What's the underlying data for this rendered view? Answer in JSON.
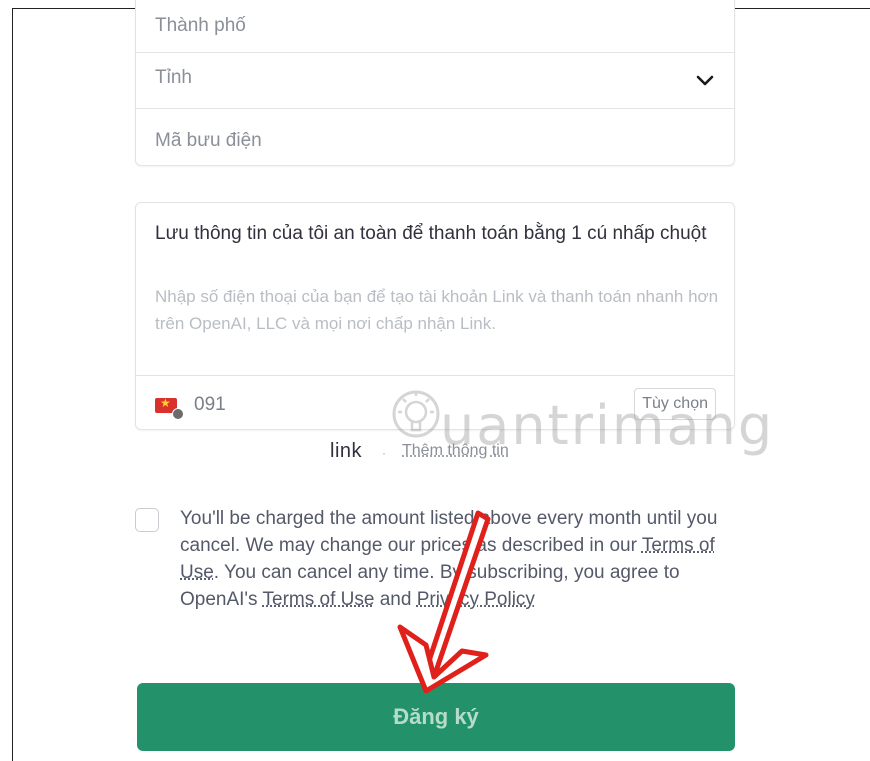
{
  "address": {
    "city_placeholder": "Thành phố",
    "province_placeholder": "Tỉnh",
    "zip_placeholder": "Mã bưu điện"
  },
  "link_save": {
    "title": "Lưu thông tin của tôi an toàn để thanh toán bằng 1 cú nhấp chuột",
    "description": "Nhập số điện thoại của bạn để tạo tài khoản Link và thanh toán nhanh hơn trên OpenAI, LLC và mọi nơi chấp nhận Link.",
    "phone_value": "091",
    "optional_label": "Tùy chọn"
  },
  "link_footer": {
    "brand": "link",
    "separator": "·",
    "more_info": "Thêm thông tin"
  },
  "consent": {
    "part1": "You'll be charged the amount listed above every month until you cancel. We may change our prices as described in our ",
    "terms1": "Terms of Use",
    "part2": ". You can cancel any time. By subscribing, you agree to OpenAI's ",
    "terms2": "Terms of Use",
    "part3": " and ",
    "privacy": "Privacy Policy"
  },
  "submit_label": "Đăng ký",
  "watermark": "uantrimang",
  "colors": {
    "button": "#23926a",
    "arrow": "#e0201b"
  }
}
